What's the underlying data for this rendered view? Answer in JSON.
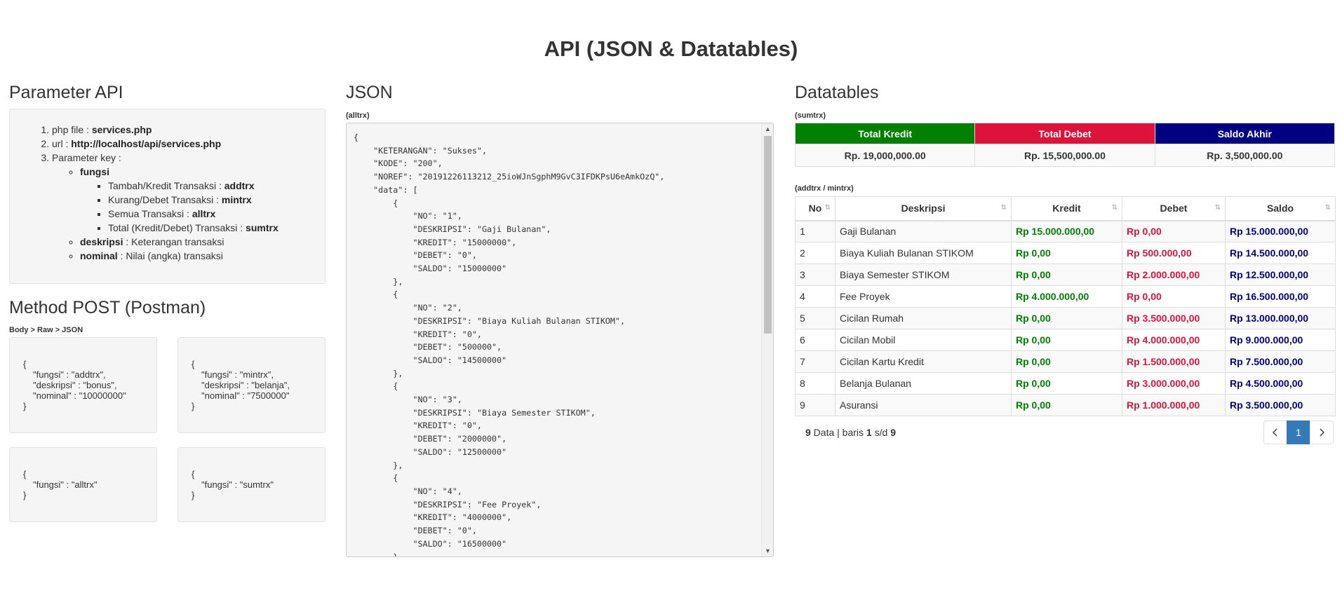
{
  "page": {
    "title": "API (JSON & Datatables)"
  },
  "param": {
    "heading": "Parameter API",
    "item1_label": "php file : ",
    "item1_value": "services.php",
    "item2_label": "url : ",
    "item2_value": "http://localhost/api/services.php",
    "item3_label": "Parameter key :",
    "fungsi": "fungsi",
    "sub": [
      {
        "label": "Tambah/Kredit Transaksi : ",
        "value": "addtrx"
      },
      {
        "label": "Kurang/Debet Transaksi : ",
        "value": "mintrx"
      },
      {
        "label": "Semua Transaksi : ",
        "value": "alltrx"
      },
      {
        "label": "Total (Kredit/Debet) Transaksi : ",
        "value": "sumtrx"
      }
    ],
    "deskripsi_key": "deskripsi",
    "deskripsi_desc": " : Keterangan transaksi",
    "nominal_key": "nominal",
    "nominal_desc": " : Nilai (angka) transaksi"
  },
  "post": {
    "heading": "Method POST (Postman)",
    "label": "Body > Raw > JSON",
    "req1": [
      "{",
      "\"fungsi\" : \"addtrx\",",
      "\"deskripsi\" : \"bonus\",",
      "\"nominal\" : \"10000000\"",
      "}"
    ],
    "req2": [
      "{",
      "\"fungsi\" : \"mintrx\",",
      "\"deskripsi\" : \"belanja\",",
      "\"nominal\" : \"7500000\"",
      "}"
    ],
    "req3": [
      "{",
      "\"fungsi\" : \"alltrx\"",
      "}"
    ],
    "req4": [
      "{",
      "\"fungsi\" : \"sumtrx\"",
      "}"
    ]
  },
  "json": {
    "heading": "JSON",
    "label": "(alltrx)",
    "text": "{\n    \"KETERANGAN\": \"Sukses\",\n    \"KODE\": \"200\",\n    \"NOREF\": \"20191226113212_25ioWJnSgphM9GvC3IFDKPsU6eAmkOzQ\",\n    \"data\": [\n        {\n            \"NO\": \"1\",\n            \"DESKRIPSI\": \"Gaji Bulanan\",\n            \"KREDIT\": \"15000000\",\n            \"DEBET\": \"0\",\n            \"SALDO\": \"15000000\"\n        },\n        {\n            \"NO\": \"2\",\n            \"DESKRIPSI\": \"Biaya Kuliah Bulanan STIKOM\",\n            \"KREDIT\": \"0\",\n            \"DEBET\": \"500000\",\n            \"SALDO\": \"14500000\"\n        },\n        {\n            \"NO\": \"3\",\n            \"DESKRIPSI\": \"Biaya Semester STIKOM\",\n            \"KREDIT\": \"0\",\n            \"DEBET\": \"2000000\",\n            \"SALDO\": \"12500000\"\n        },\n        {\n            \"NO\": \"4\",\n            \"DESKRIPSI\": \"Fee Proyek\",\n            \"KREDIT\": \"4000000\",\n            \"DEBET\": \"0\",\n            \"SALDO\": \"16500000\"\n        },"
  },
  "datatables": {
    "heading": "Datatables",
    "sum_label": "(sumtrx)",
    "sum_headers": [
      {
        "label": "Total Kredit",
        "color": "#008000"
      },
      {
        "label": "Total Debet",
        "color": "#dc143c"
      },
      {
        "label": "Saldo Akhir",
        "color": "#000080"
      }
    ],
    "sum_values": [
      "Rp. 19,000,000.00",
      "Rp. 15,500,000.00",
      "Rp. 3,500,000.00"
    ],
    "trx_label": "(addtrx / mintrx)",
    "columns": [
      "No",
      "Deskripsi",
      "Kredit",
      "Debet",
      "Saldo"
    ],
    "rows": [
      [
        "1",
        "Gaji Bulanan",
        "Rp 15.000.000,00",
        "Rp 0,00",
        "Rp 15.000.000,00"
      ],
      [
        "2",
        "Biaya Kuliah Bulanan STIKOM",
        "Rp 0,00",
        "Rp 500.000,00",
        "Rp 14.500.000,00"
      ],
      [
        "3",
        "Biaya Semester STIKOM",
        "Rp 0,00",
        "Rp 2.000.000,00",
        "Rp 12.500.000,00"
      ],
      [
        "4",
        "Fee Proyek",
        "Rp 4.000.000,00",
        "Rp 0,00",
        "Rp 16.500.000,00"
      ],
      [
        "5",
        "Cicilan Rumah",
        "Rp 0,00",
        "Rp 3.500.000,00",
        "Rp 13.000.000,00"
      ],
      [
        "6",
        "Cicilan Mobil",
        "Rp 0,00",
        "Rp 4.000.000,00",
        "Rp 9.000.000,00"
      ],
      [
        "7",
        "Cicilan Kartu Kredit",
        "Rp 0,00",
        "Rp 1.500.000,00",
        "Rp 7.500.000,00"
      ],
      [
        "8",
        "Belanja Bulanan",
        "Rp 0,00",
        "Rp 3.000.000,00",
        "Rp 4.500.000,00"
      ],
      [
        "9",
        "Asuransi",
        "Rp 0,00",
        "Rp 1.000.000,00",
        "Rp 3.500.000,00"
      ]
    ],
    "info": {
      "count": "9",
      "text1": " Data | baris ",
      "from": "1",
      "sep": " s/d ",
      "to": "9"
    },
    "pager": {
      "prev_icon": "chevron-left-icon",
      "page": "1",
      "next_icon": "chevron-right-icon"
    }
  }
}
